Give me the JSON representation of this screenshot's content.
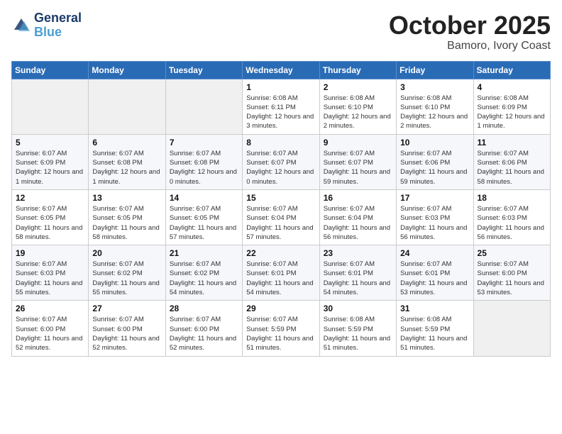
{
  "header": {
    "logo_line1": "General",
    "logo_line2": "Blue",
    "month": "October 2025",
    "location": "Bamoro, Ivory Coast"
  },
  "weekdays": [
    "Sunday",
    "Monday",
    "Tuesday",
    "Wednesday",
    "Thursday",
    "Friday",
    "Saturday"
  ],
  "weeks": [
    [
      {
        "day": "",
        "empty": true
      },
      {
        "day": "",
        "empty": true
      },
      {
        "day": "",
        "empty": true
      },
      {
        "day": "1",
        "sunrise": "6:08 AM",
        "sunset": "6:11 PM",
        "daylight": "12 hours and 3 minutes."
      },
      {
        "day": "2",
        "sunrise": "6:08 AM",
        "sunset": "6:10 PM",
        "daylight": "12 hours and 2 minutes."
      },
      {
        "day": "3",
        "sunrise": "6:08 AM",
        "sunset": "6:10 PM",
        "daylight": "12 hours and 2 minutes."
      },
      {
        "day": "4",
        "sunrise": "6:08 AM",
        "sunset": "6:09 PM",
        "daylight": "12 hours and 1 minute."
      }
    ],
    [
      {
        "day": "5",
        "sunrise": "6:07 AM",
        "sunset": "6:09 PM",
        "daylight": "12 hours and 1 minute."
      },
      {
        "day": "6",
        "sunrise": "6:07 AM",
        "sunset": "6:08 PM",
        "daylight": "12 hours and 1 minute."
      },
      {
        "day": "7",
        "sunrise": "6:07 AM",
        "sunset": "6:08 PM",
        "daylight": "12 hours and 0 minutes."
      },
      {
        "day": "8",
        "sunrise": "6:07 AM",
        "sunset": "6:07 PM",
        "daylight": "12 hours and 0 minutes."
      },
      {
        "day": "9",
        "sunrise": "6:07 AM",
        "sunset": "6:07 PM",
        "daylight": "11 hours and 59 minutes."
      },
      {
        "day": "10",
        "sunrise": "6:07 AM",
        "sunset": "6:06 PM",
        "daylight": "11 hours and 59 minutes."
      },
      {
        "day": "11",
        "sunrise": "6:07 AM",
        "sunset": "6:06 PM",
        "daylight": "11 hours and 58 minutes."
      }
    ],
    [
      {
        "day": "12",
        "sunrise": "6:07 AM",
        "sunset": "6:05 PM",
        "daylight": "11 hours and 58 minutes."
      },
      {
        "day": "13",
        "sunrise": "6:07 AM",
        "sunset": "6:05 PM",
        "daylight": "11 hours and 58 minutes."
      },
      {
        "day": "14",
        "sunrise": "6:07 AM",
        "sunset": "6:05 PM",
        "daylight": "11 hours and 57 minutes."
      },
      {
        "day": "15",
        "sunrise": "6:07 AM",
        "sunset": "6:04 PM",
        "daylight": "11 hours and 57 minutes."
      },
      {
        "day": "16",
        "sunrise": "6:07 AM",
        "sunset": "6:04 PM",
        "daylight": "11 hours and 56 minutes."
      },
      {
        "day": "17",
        "sunrise": "6:07 AM",
        "sunset": "6:03 PM",
        "daylight": "11 hours and 56 minutes."
      },
      {
        "day": "18",
        "sunrise": "6:07 AM",
        "sunset": "6:03 PM",
        "daylight": "11 hours and 56 minutes."
      }
    ],
    [
      {
        "day": "19",
        "sunrise": "6:07 AM",
        "sunset": "6:03 PM",
        "daylight": "11 hours and 55 minutes."
      },
      {
        "day": "20",
        "sunrise": "6:07 AM",
        "sunset": "6:02 PM",
        "daylight": "11 hours and 55 minutes."
      },
      {
        "day": "21",
        "sunrise": "6:07 AM",
        "sunset": "6:02 PM",
        "daylight": "11 hours and 54 minutes."
      },
      {
        "day": "22",
        "sunrise": "6:07 AM",
        "sunset": "6:01 PM",
        "daylight": "11 hours and 54 minutes."
      },
      {
        "day": "23",
        "sunrise": "6:07 AM",
        "sunset": "6:01 PM",
        "daylight": "11 hours and 54 minutes."
      },
      {
        "day": "24",
        "sunrise": "6:07 AM",
        "sunset": "6:01 PM",
        "daylight": "11 hours and 53 minutes."
      },
      {
        "day": "25",
        "sunrise": "6:07 AM",
        "sunset": "6:00 PM",
        "daylight": "11 hours and 53 minutes."
      }
    ],
    [
      {
        "day": "26",
        "sunrise": "6:07 AM",
        "sunset": "6:00 PM",
        "daylight": "11 hours and 52 minutes."
      },
      {
        "day": "27",
        "sunrise": "6:07 AM",
        "sunset": "6:00 PM",
        "daylight": "11 hours and 52 minutes."
      },
      {
        "day": "28",
        "sunrise": "6:07 AM",
        "sunset": "6:00 PM",
        "daylight": "11 hours and 52 minutes."
      },
      {
        "day": "29",
        "sunrise": "6:07 AM",
        "sunset": "5:59 PM",
        "daylight": "11 hours and 51 minutes."
      },
      {
        "day": "30",
        "sunrise": "6:08 AM",
        "sunset": "5:59 PM",
        "daylight": "11 hours and 51 minutes."
      },
      {
        "day": "31",
        "sunrise": "6:08 AM",
        "sunset": "5:59 PM",
        "daylight": "11 hours and 51 minutes."
      },
      {
        "day": "",
        "empty": true
      }
    ]
  ]
}
